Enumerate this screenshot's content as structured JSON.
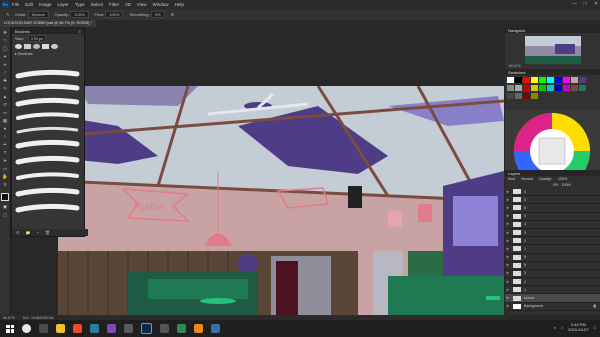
{
  "menu": {
    "app_icon": "Ps",
    "items": [
      "File",
      "Edit",
      "Image",
      "Layer",
      "Type",
      "Select",
      "Filter",
      "3D",
      "View",
      "Window",
      "Help"
    ],
    "window_controls": [
      "minimize-icon",
      "maximize-icon",
      "close-icon"
    ]
  },
  "options": {
    "mode_label": "Mode:",
    "mode_value": "Normal",
    "opacity_label": "Opacity:",
    "opacity_value": "100%",
    "flow_label": "Flow:",
    "flow_value": "100%",
    "smoothing_label": "Smoothing:",
    "smoothing_value": "0%"
  },
  "document": {
    "tab_title": "LOCATION BAR GOBBY.psd @ 66.7% (5, RGB/8) *"
  },
  "brushes_panel": {
    "title": "Brushes",
    "size_label": "Size:",
    "size_value": "178 px",
    "group_name": "Brushes"
  },
  "navigator": {
    "title": "Navigator",
    "zoom": "66.67%"
  },
  "swatches": {
    "title": "Swatches"
  },
  "layers": {
    "title": "Layers",
    "kind_label": "Kind",
    "mode": "Normal",
    "opacity_label": "Opacity:",
    "opacity": "100%",
    "fill_label": "Fill:",
    "fill": "100%",
    "rows": [
      {
        "name": "5"
      },
      {
        "name": "5"
      },
      {
        "name": "6"
      },
      {
        "name": "5"
      },
      {
        "name": "4"
      },
      {
        "name": "3"
      },
      {
        "name": "2"
      },
      {
        "name": "1"
      },
      {
        "name": "5"
      },
      {
        "name": "5"
      },
      {
        "name": "3"
      },
      {
        "name": "2"
      },
      {
        "name": "1"
      },
      {
        "name": "sketch"
      },
      {
        "name": "Background"
      }
    ]
  },
  "status": {
    "zoom": "66.67%",
    "doc_info": "Doc: 19.8M/236.3M"
  },
  "taskbar": {
    "time": "2:45 PM",
    "date": "2020-04-07"
  },
  "colors": {
    "wall": "#c9a3a4",
    "ceiling": "#c4ccd6",
    "purple": "#4f3c86",
    "beam": "#7a4c3f",
    "green": "#1f7a54"
  }
}
